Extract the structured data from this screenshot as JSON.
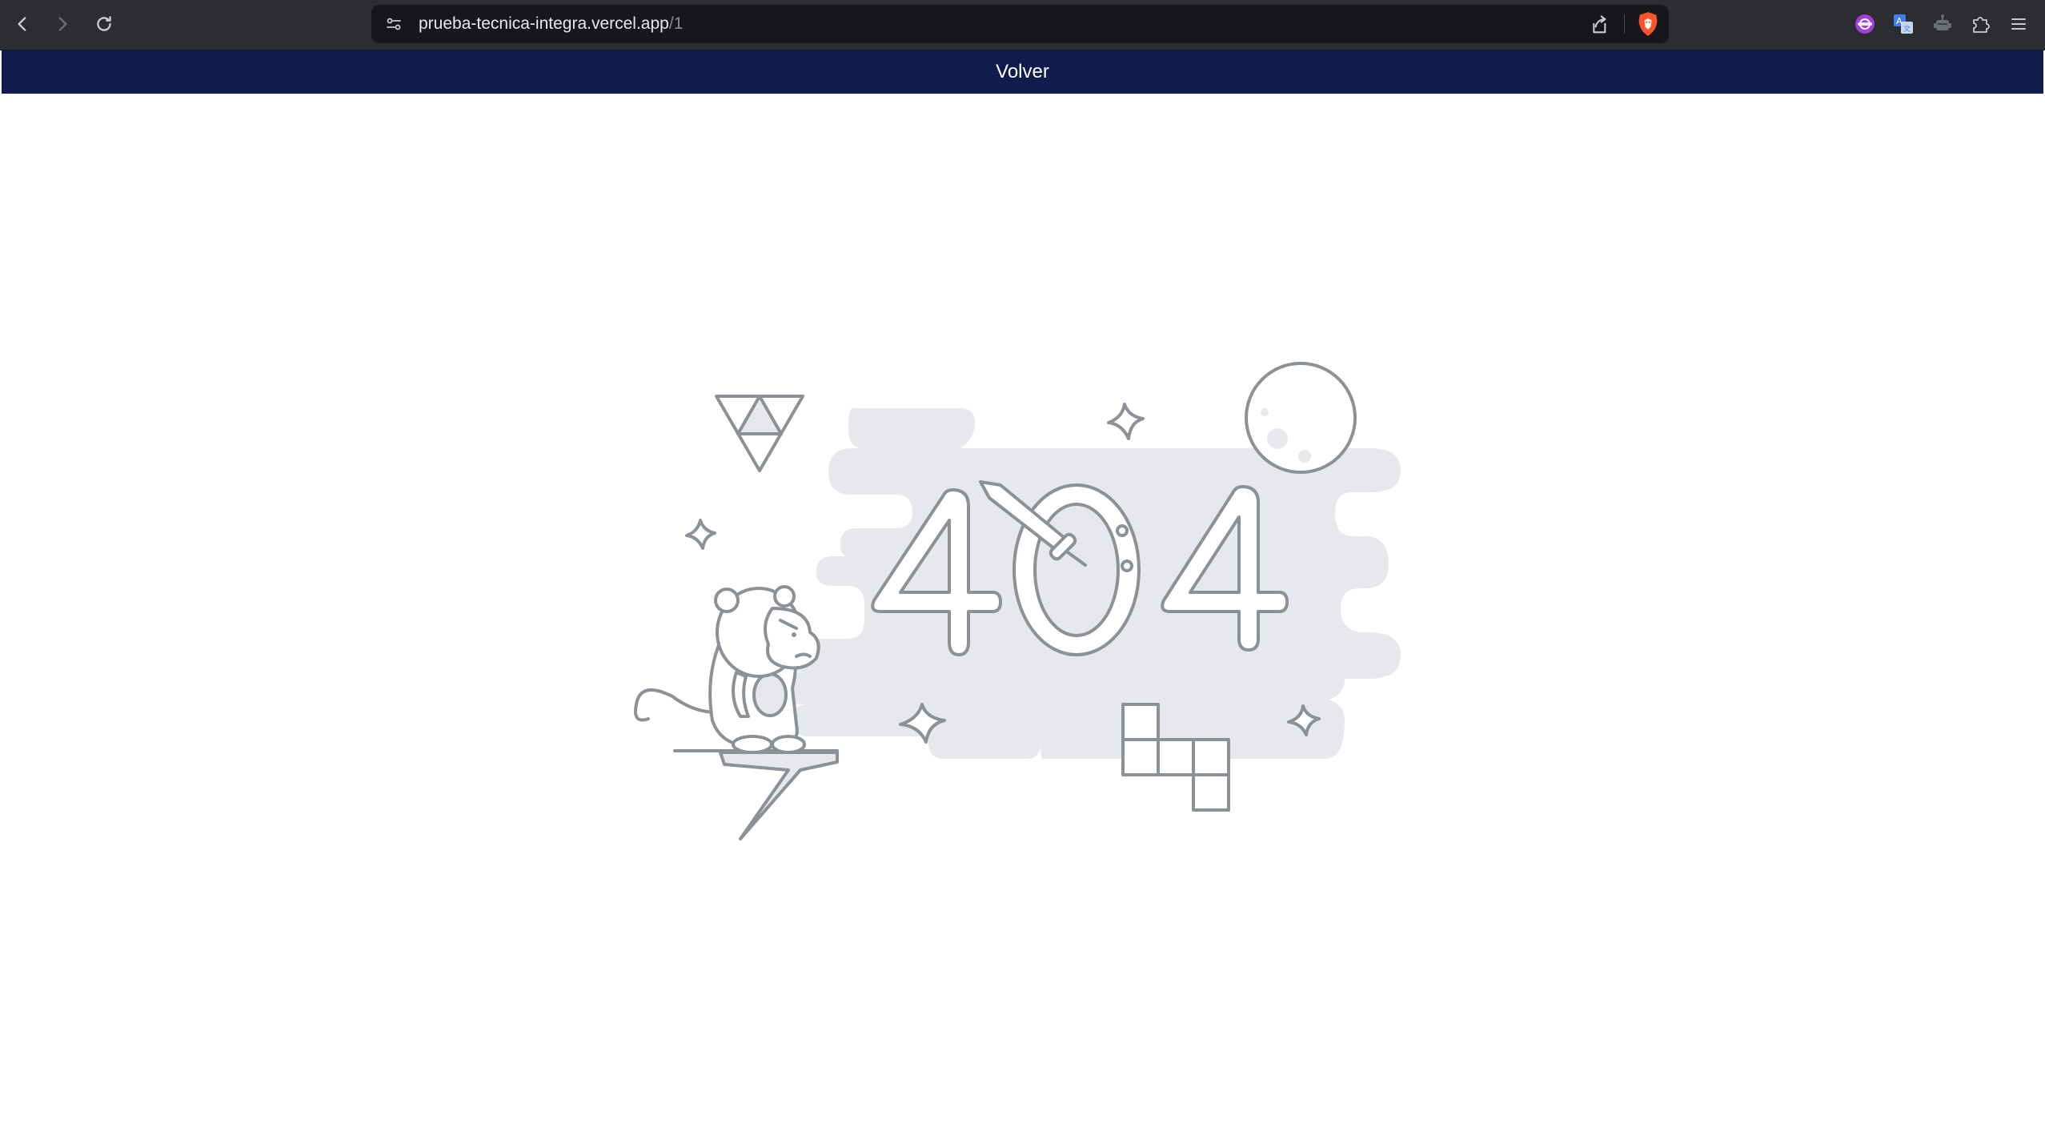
{
  "browser": {
    "url_host": "prueba-tecnica-integra.vercel.app",
    "url_path": "/1",
    "icons": {
      "back": "back-arrow-icon",
      "forward": "forward-arrow-icon",
      "reload": "reload-icon",
      "site_settings": "site-settings-icon",
      "share": "share-icon",
      "brave_shields": "brave-shield-icon",
      "extensions": [
        "purple-extension-icon",
        "translate-icon",
        "robot-icon",
        "puzzle-icon",
        "menu-icon"
      ]
    }
  },
  "app": {
    "header_bg": "#111c4e",
    "back_label": "Volver"
  },
  "error": {
    "code": "404",
    "illustration": "404-monkey-illustration"
  }
}
